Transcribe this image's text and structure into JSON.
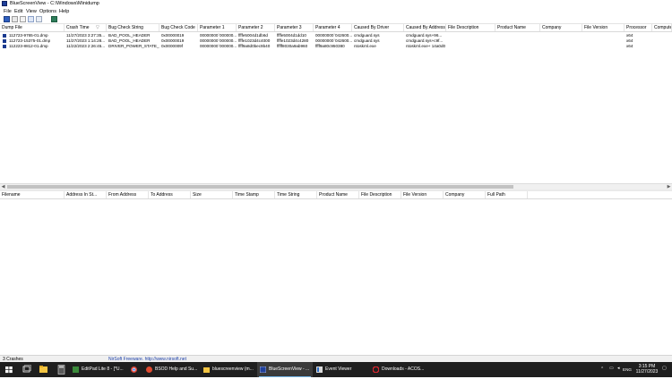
{
  "window": {
    "title": "BlueScreenView  -  C:\\Windows\\Minidump"
  },
  "menu": [
    "File",
    "Edit",
    "View",
    "Options",
    "Help"
  ],
  "toolbar": {
    "icons": [
      "save-icon",
      "copy-icon",
      "properties-icon",
      "html-report-icon",
      "refresh-icon",
      "exit-icon"
    ]
  },
  "top_table": {
    "headers": [
      "Dump File",
      "Crash Time",
      "Bug Check String",
      "Bug Check Code",
      "Parameter 1",
      "Parameter 2",
      "Parameter 3",
      "Parameter 4",
      "Caused By Driver",
      "Caused By Address",
      "File Description",
      "Product Name",
      "Company",
      "File Version",
      "Processor",
      "Computer"
    ],
    "sort_indicator": "▽",
    "rows": [
      [
        "112723-9765-01.dmp",
        "11/27/2023 3:27:35...",
        "BAD_POOL_HEADER",
        "0x00000019",
        "00000000`000000...",
        "ffffe5004d1db6d",
        "ffffe5004d1dd10",
        "00000000`042600...",
        "cmdguard.sys",
        "cmdguard.sys+96...",
        "",
        "",
        "",
        "",
        "x64",
        ""
      ],
      [
        "112723-15375-01.dmp",
        "11/27/2023 1:14:28...",
        "BAD_POOL_HEADER",
        "0x00000019",
        "00000000`000000...",
        "ffffe1023d4c4000",
        "ffffe1023d4c4280",
        "00000000`042600...",
        "cmdguard.sys",
        "cmdguard.sys+c9f...",
        "",
        "",
        "",
        "",
        "x64",
        ""
      ],
      [
        "112223-8812-01.dmp",
        "11/22/2023 2:26:45...",
        "DRIVER_POWER_STATE_...",
        "0x0000009f",
        "00000000`000000...",
        "ffff9a8d0bec9b40",
        "fffff8030a9ab960",
        "ffff9a80c950380",
        "ntoskrnl.exe",
        "ntoskrnl.exe+ 14a0d0",
        "",
        "",
        "",
        "",
        "x64",
        ""
      ]
    ]
  },
  "bottom_table": {
    "headers": [
      "Filename",
      "Address In St...",
      "From Address",
      "To Address",
      "Size",
      "Time Stamp",
      "Time String",
      "Product Name",
      "File Description",
      "File Version",
      "Company",
      "Full Path"
    ]
  },
  "status": {
    "crashes": "3 Crashes",
    "credit": "NirSoft Freeware.  http://www.nirsoft.net"
  },
  "taskbar": {
    "apps": [
      {
        "label": "EditPad Lite 8 - [*U...",
        "icon": "editpad-icon",
        "active": false
      },
      {
        "label": "",
        "icon": "chrome-icon",
        "active": false
      },
      {
        "label": "BSOD Help and Su...",
        "icon": "browser-icon",
        "active": false
      },
      {
        "label": "bluescreenview (m...",
        "icon": "folder-icon",
        "active": false
      },
      {
        "label": "BlueScreenView  -  ...",
        "icon": "bluescreenview-icon",
        "active": true
      },
      {
        "label": "Event Viewer",
        "icon": "event-viewer-icon",
        "active": false
      },
      {
        "label": "Downloads - ACOS...",
        "icon": "opera-icon",
        "active": false
      }
    ],
    "lang": "ENG",
    "time": "3:15 PM",
    "date": "11/27/2023",
    "accent": "#76b9ed"
  }
}
